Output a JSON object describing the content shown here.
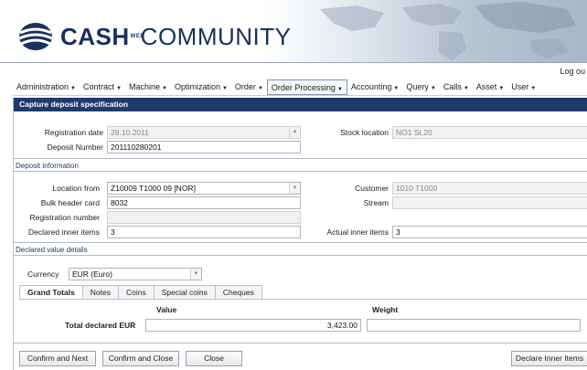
{
  "header": {
    "brand_cash": "CASH",
    "brand_small": "WEB",
    "brand_community": "COMMUNITY",
    "logout_label": "Log ou"
  },
  "menu": [
    {
      "label": "Administration",
      "active": false
    },
    {
      "label": "Contract",
      "active": false
    },
    {
      "label": "Machine",
      "active": false
    },
    {
      "label": "Optimization",
      "active": false
    },
    {
      "label": "Order",
      "active": false
    },
    {
      "label": "Order Processing",
      "active": true
    },
    {
      "label": "Accounting",
      "active": false
    },
    {
      "label": "Query",
      "active": false
    },
    {
      "label": "Calls",
      "active": false
    },
    {
      "label": "Asset",
      "active": false
    },
    {
      "label": "User",
      "active": false
    }
  ],
  "panel": {
    "title": "Capture deposit specification"
  },
  "registration": {
    "date_label": "Registration date",
    "date_value": "28.10.2011",
    "deposit_label": "Deposit Number",
    "deposit_value": "201110280201",
    "stock_label": "Stock location",
    "stock_value": "NO1 SL20"
  },
  "deposit_info": {
    "section_title": "Deposit information",
    "location_from_label": "Location from",
    "location_from_value": "Z10009 T1000 09 [NOR]",
    "customer_label": "Customer",
    "customer_value": "1010 T1000",
    "bulk_header_label": "Bulk header card",
    "bulk_header_value": "8032",
    "stream_label": "Stream",
    "stream_value": "",
    "registration_number_label": "Registration number",
    "registration_number_value": "",
    "declared_inner_label": "Declared inner items",
    "declared_inner_value": "3",
    "actual_inner_label": "Actual inner items",
    "actual_inner_value": "3"
  },
  "declared_value": {
    "section_title": "Declared value details",
    "currency_label": "Currency",
    "currency_value": "EUR (Euro)",
    "tabs": [
      "Grand Totals",
      "Notes",
      "Coins",
      "Special coins",
      "Cheques"
    ],
    "active_tab": "Grand Totals",
    "value_header": "Value",
    "weight_header": "Weight",
    "total_label": "Total declared EUR",
    "total_value": "3,423.00",
    "weight_value": ""
  },
  "buttons": {
    "confirm_next": "Confirm and Next",
    "confirm_close": "Confirm and Close",
    "close": "Close",
    "declare_inner": "Declare Inner Items"
  },
  "colors": {
    "panel_title_bg": "#1f3a6d",
    "section_title": "#1f3a6d",
    "brand": "#1a2f5e"
  }
}
